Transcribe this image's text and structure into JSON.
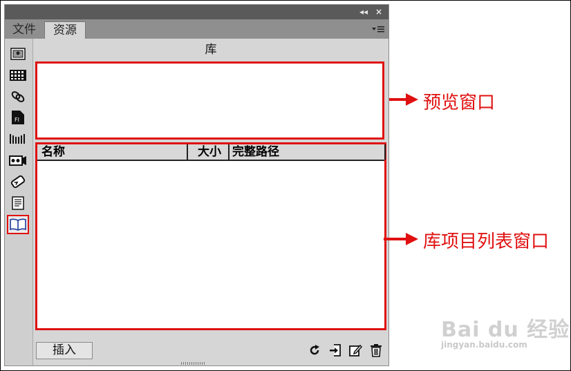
{
  "panel": {
    "title_controls": {
      "collapse": "◂◂",
      "close": "×"
    },
    "tabs": [
      {
        "label": "文件",
        "active": false
      },
      {
        "label": "资源",
        "active": true
      }
    ],
    "section_title": "库",
    "sidebar_icons": [
      "images-icon",
      "colors-icon",
      "urls-icon",
      "flash-icon",
      "shockwave-icon",
      "movies-icon",
      "scripts-icon",
      "templates-icon",
      "library-icon"
    ],
    "selected_icon": "library-icon",
    "list_columns": [
      "名称",
      "大小",
      "完整路径"
    ],
    "insert_button": "插入",
    "bottom_icons": [
      "refresh-icon",
      "new-item-icon",
      "edit-icon",
      "delete-icon"
    ]
  },
  "annotations": {
    "preview": "预览窗口",
    "list": "库项目列表窗口"
  },
  "watermark": {
    "brand": "Bai du 经验",
    "site": "jingyan.baidu.com"
  },
  "colors": {
    "highlight": "#e01010",
    "panel_bg": "#d6d6d6",
    "titlebar": "#5a5a5a"
  }
}
